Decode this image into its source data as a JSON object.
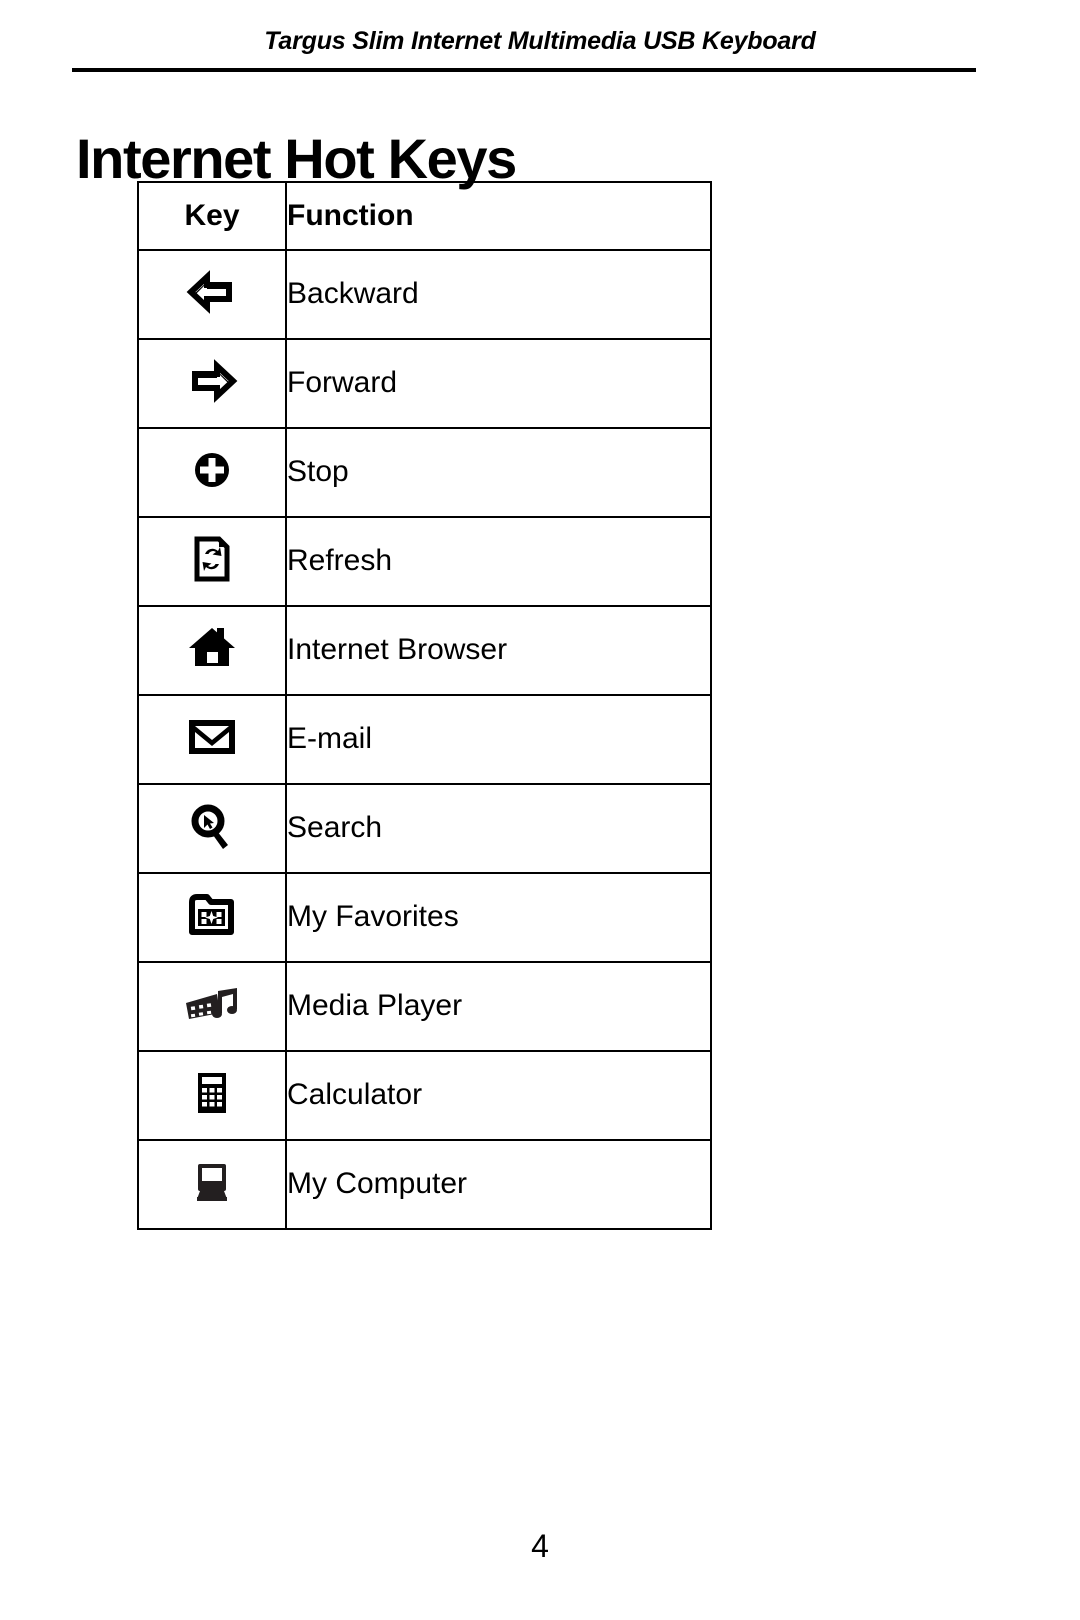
{
  "header": {
    "running_title": "Targus Slim Internet Multimedia USB Keyboard"
  },
  "title": "Internet Hot Keys",
  "table": {
    "columns": [
      "Key",
      "Function"
    ],
    "rows": [
      {
        "icon": "arrow-left-icon",
        "function": "Backward"
      },
      {
        "icon": "arrow-right-icon",
        "function": "Forward"
      },
      {
        "icon": "stop-circle-icon",
        "function": "Stop"
      },
      {
        "icon": "refresh-page-icon",
        "function": "Refresh"
      },
      {
        "icon": "house-icon",
        "function": "Internet Browser"
      },
      {
        "icon": "envelope-icon",
        "function": "E-mail"
      },
      {
        "icon": "magnifier-icon",
        "function": "Search"
      },
      {
        "icon": "folder-star-icon",
        "function": "My Favorites"
      },
      {
        "icon": "film-music-note-icon",
        "function": "Media Player"
      },
      {
        "icon": "calculator-icon",
        "function": "Calculator"
      },
      {
        "icon": "computer-monitor-icon",
        "function": "My Computer"
      }
    ]
  },
  "page_number": "4",
  "colors": {
    "ink": "#000000",
    "paper": "#ffffff"
  }
}
